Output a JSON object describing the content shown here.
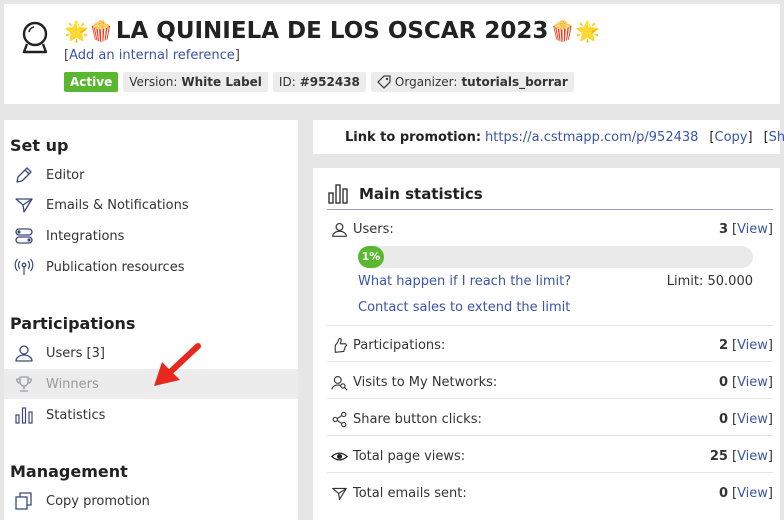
{
  "header": {
    "title": "LA QUINIELA DE LOS OSCAR 2023",
    "title_emoji_left": "🌟🍿",
    "title_emoji_right": "🍿🌟",
    "internal_ref_link": "Add an internal reference",
    "badges": {
      "status": "Active",
      "version_label": "Version:",
      "version_value": "White Label",
      "id_label": "ID:",
      "id_value": "#952438",
      "organizer_label": "Organizer:",
      "organizer_value": "tutorials_borrar"
    }
  },
  "sidebar": {
    "setup_title": "Set up",
    "setup_items": [
      "Editor",
      "Emails & Notifications",
      "Integrations",
      "Publication resources"
    ],
    "participations_title": "Participations",
    "participation_items": [
      "Users [3]",
      "Winners",
      "Statistics"
    ],
    "management_title": "Management",
    "management_items": [
      "Copy promotion"
    ]
  },
  "promo": {
    "label": "Link to promotion:",
    "url": "https://a.cstmapp.com/p/952438",
    "copy": "Copy",
    "share": "Share"
  },
  "stats": {
    "title": "Main statistics",
    "users": {
      "label": "Users:",
      "value": "3",
      "view": "View"
    },
    "progress_percent": 1,
    "progress_label": "1%",
    "limit_link": "What happen if I reach the limit?",
    "limit_text": "Limit: 50.000",
    "contact_link": "Contact sales to extend the limit",
    "rows": [
      {
        "label": "Participations:",
        "value": "2",
        "view": "View",
        "icon": "hand-icon"
      },
      {
        "label": "Visits to My Networks:",
        "value": "0",
        "view": "View",
        "icon": "user-search-icon"
      },
      {
        "label": "Share button clicks:",
        "value": "0",
        "view": "View",
        "icon": "share-icon"
      },
      {
        "label": "Total page views:",
        "value": "25",
        "view": "View",
        "icon": "eye-icon"
      },
      {
        "label": "Total emails sent:",
        "value": "0",
        "view": "View",
        "icon": "send-icon"
      }
    ]
  },
  "colors": {
    "accent_green": "#5ab830",
    "link_blue": "#3b55a8",
    "arrow_red": "#e8281e"
  }
}
